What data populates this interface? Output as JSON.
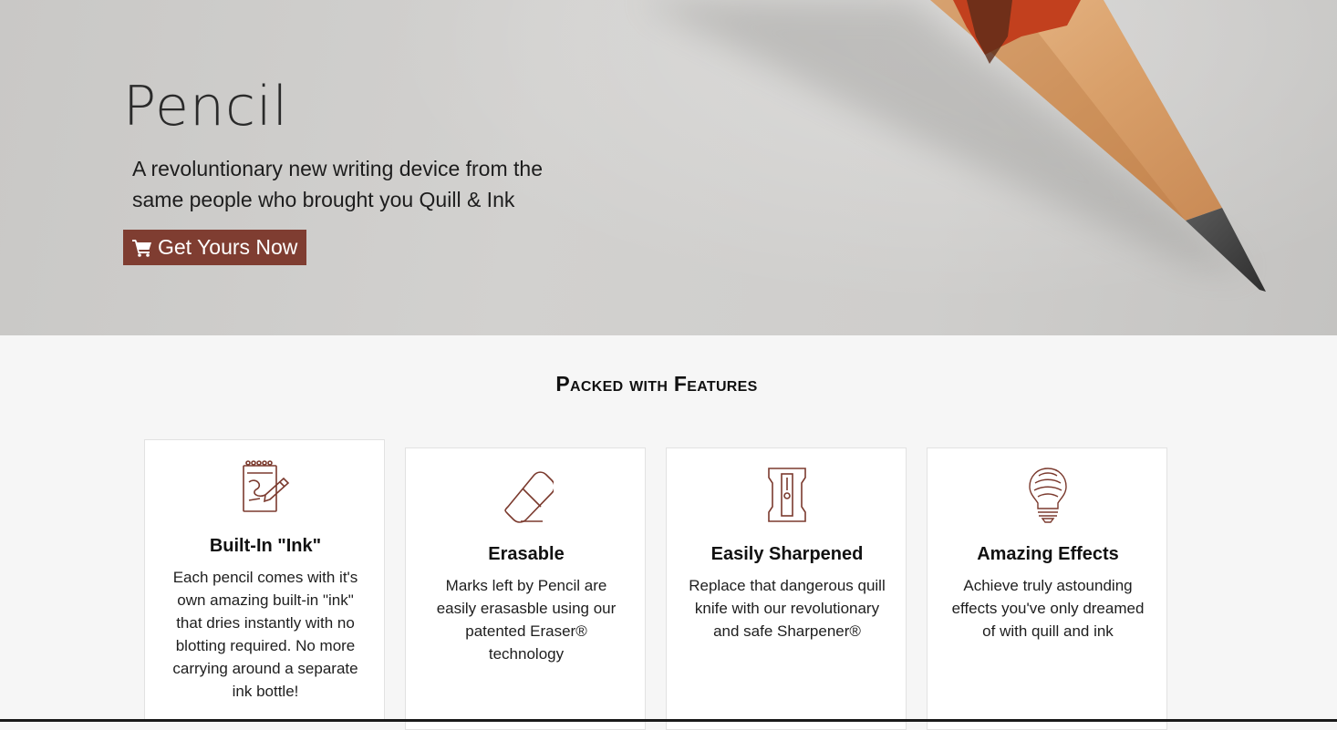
{
  "hero": {
    "title": "Pencil",
    "subtitle": "A revoluntionary new writing device from the same people who brought you Quill & Ink",
    "cta_label": "Get Yours Now",
    "cta_icon": "shopping-cart-icon"
  },
  "features": {
    "heading": "Packed with Features",
    "items": [
      {
        "icon": "notepad-pencil-icon",
        "title": "Built-In \"Ink\"",
        "text": "Each pencil comes with it's own amazing built-in \"ink\" that dries instantly with no blotting required. No more carrying around a separate ink bottle!"
      },
      {
        "icon": "eraser-icon",
        "title": "Erasable",
        "text": "Marks left by Pencil are easily erasasble using our patented Eraser® technology"
      },
      {
        "icon": "sharpener-icon",
        "title": "Easily Sharpened",
        "text": "Replace that dangerous quill knife with our revolutionary and safe Sharpener®"
      },
      {
        "icon": "lightbulb-icon",
        "title": "Amazing Effects",
        "text": "Achieve truly astounding effects you've only dreamed of with quill and ink"
      }
    ]
  },
  "colors": {
    "accent": "#7f3d31",
    "icon_stroke": "#7b3a2e",
    "background": "#f6f6f6"
  }
}
